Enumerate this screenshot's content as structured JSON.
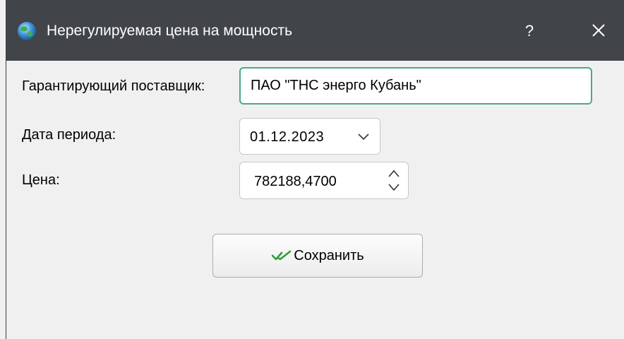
{
  "window": {
    "title": "Нерегулируемая цена на мощность",
    "help_label": "?",
    "icons": {
      "app": "globe-icon",
      "close": "close-icon"
    }
  },
  "form": {
    "supplier_label": "Гарантирующий поставщик:",
    "supplier_value": "ПАО \"ТНС энерго Кубань\"",
    "period_label": "Дата периода:",
    "period_value": "01.12.2023",
    "price_label": "Цена:",
    "price_value": "782188,4700"
  },
  "actions": {
    "save_label": "Сохранить",
    "save_icon": "double-check-icon"
  },
  "colors": {
    "titlebar": "#414549",
    "focus_border": "#4aa88a",
    "check_icon": "#2e9e3a",
    "background": "#f0f0f0"
  }
}
